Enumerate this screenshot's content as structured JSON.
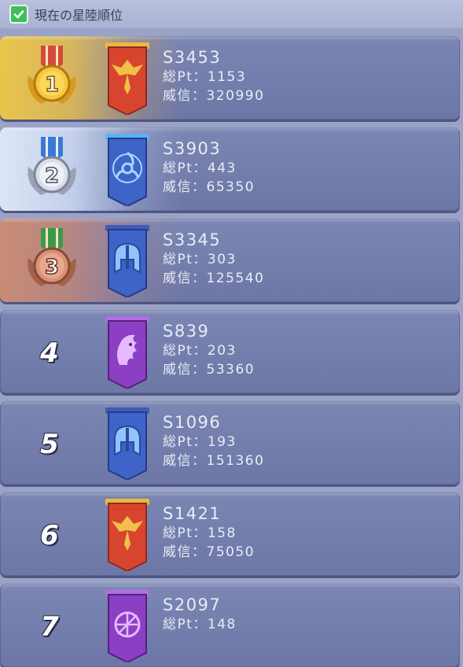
{
  "header": {
    "label": "現在の星陸順位",
    "checked": true
  },
  "rows": [
    {
      "rank": "1",
      "server": "S3453",
      "points": "総Pt：1153",
      "prestige": "威信：320990",
      "medal": "gold",
      "emblem": "phoenix",
      "banner_color": "#d8452f"
    },
    {
      "rank": "2",
      "server": "S3903",
      "points": "総Pt：443",
      "prestige": "威信：65350",
      "medal": "silver",
      "emblem": "triskelion",
      "banner_color": "#3f63c7"
    },
    {
      "rank": "3",
      "server": "S3345",
      "points": "総Pt：303",
      "prestige": "威信：125540",
      "medal": "bronze",
      "emblem": "helmet",
      "banner_color": "#3f63c7"
    },
    {
      "rank": "4",
      "server": "S839",
      "points": "総Pt：203",
      "prestige": "威信：53360",
      "medal": "none",
      "emblem": "lion",
      "banner_color": "#8a3fc4"
    },
    {
      "rank": "5",
      "server": "S1096",
      "points": "総Pt：193",
      "prestige": "威信：151360",
      "medal": "none",
      "emblem": "helmet",
      "banner_color": "#3f63c7"
    },
    {
      "rank": "6",
      "server": "S1421",
      "points": "総Pt：158",
      "prestige": "威信：75050",
      "medal": "none",
      "emblem": "phoenix",
      "banner_color": "#d8452f"
    },
    {
      "rank": "7",
      "server": "S2097",
      "points": "総Pt：148",
      "prestige": "",
      "medal": "none",
      "emblem": "compass",
      "banner_color": "#8a3fc4"
    }
  ]
}
